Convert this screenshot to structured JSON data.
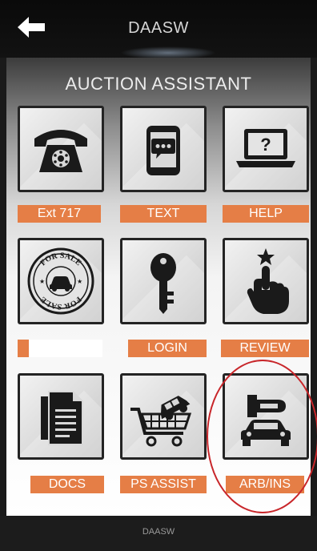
{
  "header": {
    "title": "DAASW",
    "back_icon": "arrow-left-icon"
  },
  "main": {
    "title": "AUCTION ASSISTANT",
    "tiles": [
      {
        "label": "Ext 717",
        "icon": "telephone-icon"
      },
      {
        "label": "TEXT",
        "icon": "smartphone-chat-icon"
      },
      {
        "label": "HELP",
        "icon": "laptop-question-icon"
      },
      {
        "label": "",
        "icon": "for-sale-stamp-icon",
        "stamp_text_top": "FOR SALE",
        "stamp_text_bottom": "FOR SALE"
      },
      {
        "label": "LOGIN",
        "icon": "key-icon"
      },
      {
        "label": "REVIEW",
        "icon": "hand-pointer-star-icon"
      },
      {
        "label": "DOCS",
        "icon": "documents-icon"
      },
      {
        "label": "PS ASSIST",
        "icon": "cart-with-car-icon"
      },
      {
        "label": "ARB/INS",
        "icon": "car-wrench-icon"
      }
    ]
  },
  "footer": {
    "text": "DAASW"
  },
  "colors": {
    "label_bg": "#e57e46",
    "highlight": "#c8262a",
    "tile_border": "#242424"
  }
}
